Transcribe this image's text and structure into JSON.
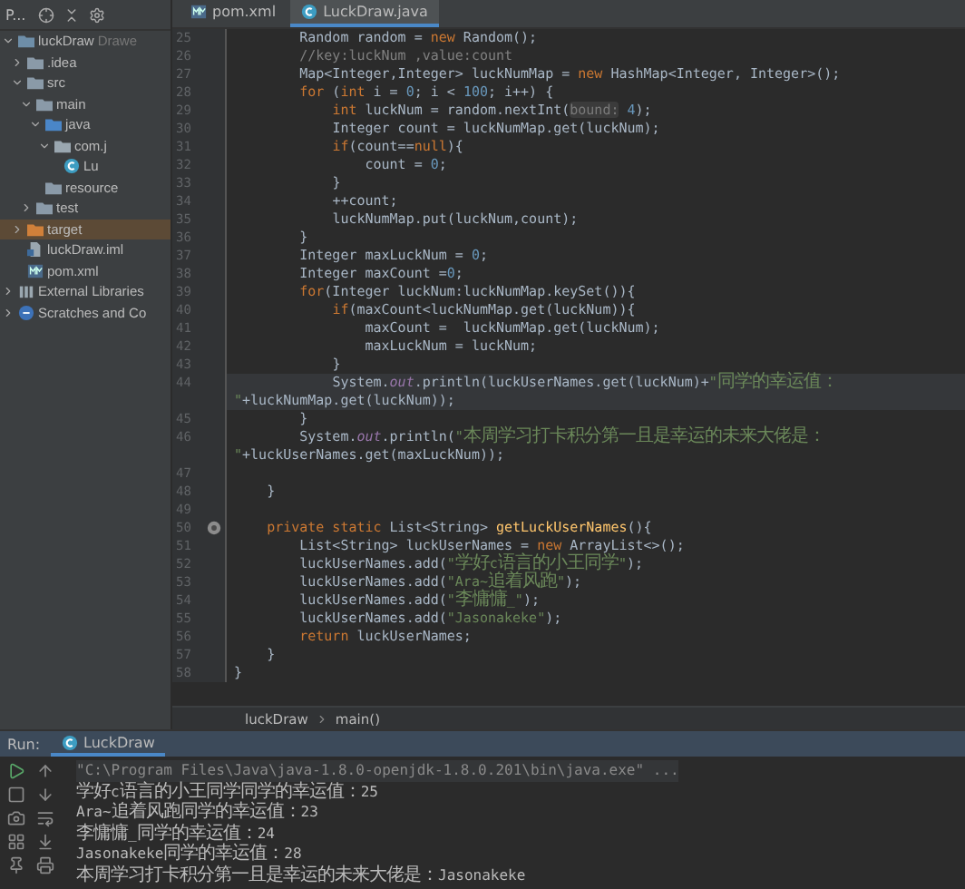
{
  "project_panel": {
    "title": "P...",
    "tree": [
      {
        "label": "luckDraw",
        "hint": "Drawe",
        "kind": "module",
        "expanded": true,
        "selected": false,
        "children": [
          {
            "label": ".idea",
            "kind": "folder",
            "expanded": false,
            "selected": false
          },
          {
            "label": "src",
            "kind": "folder",
            "expanded": true,
            "selected": false,
            "children": [
              {
                "label": "main",
                "kind": "folder",
                "expanded": true,
                "selected": false,
                "children": [
                  {
                    "label": "java",
                    "kind": "source",
                    "expanded": true,
                    "selected": false,
                    "children": [
                      {
                        "label": "com.j",
                        "kind": "package",
                        "expanded": true,
                        "selected": false,
                        "children": [
                          {
                            "label": "Lu",
                            "kind": "class",
                            "selected": false
                          }
                        ]
                      }
                    ]
                  },
                  {
                    "label": "resource",
                    "kind": "resources",
                    "selected": false
                  }
                ]
              },
              {
                "label": "test",
                "kind": "folder",
                "expanded": false,
                "selected": false
              }
            ]
          },
          {
            "label": "target",
            "kind": "excluded",
            "expanded": false,
            "selected": true
          },
          {
            "label": "luckDraw.iml",
            "kind": "iml",
            "selected": false
          },
          {
            "label": "pom.xml",
            "kind": "maven",
            "selected": false
          }
        ]
      },
      {
        "label": "External Libraries",
        "kind": "library",
        "expanded": false,
        "selected": false
      },
      {
        "label": "Scratches and Co",
        "kind": "scratch",
        "expanded": false,
        "selected": false
      }
    ]
  },
  "editor": {
    "tabs": [
      {
        "label": "pom.xml",
        "kind": "maven",
        "selected": false
      },
      {
        "label": "LuckDraw.java",
        "kind": "class",
        "selected": true
      }
    ],
    "lines": [
      {
        "number": "25",
        "current": false,
        "tokens": [
          {
            "text": "        Random random = ",
            "kind": "plain"
          },
          {
            "text": "new",
            "kind": "kw"
          },
          {
            "text": " Random();",
            "kind": "plain"
          }
        ]
      },
      {
        "number": "26",
        "current": false,
        "tokens": [
          {
            "text": "        //key:luckNum ,value:count",
            "kind": "comment"
          }
        ]
      },
      {
        "number": "27",
        "current": false,
        "tokens": [
          {
            "text": "        Map<Integer,Integer> luckNumMap = ",
            "kind": "plain"
          },
          {
            "text": "new",
            "kind": "kw"
          },
          {
            "text": " HashMap<Integer, Integer>();",
            "kind": "plain"
          }
        ]
      },
      {
        "number": "28",
        "current": false,
        "tokens": [
          {
            "text": "        for",
            "kind": "kw"
          },
          {
            "text": " (",
            "kind": "plain"
          },
          {
            "text": "int",
            "kind": "kw"
          },
          {
            "text": " i = ",
            "kind": "plain"
          },
          {
            "text": "0",
            "kind": "num"
          },
          {
            "text": "; i < ",
            "kind": "plain"
          },
          {
            "text": "100",
            "kind": "num"
          },
          {
            "text": "; i++) {",
            "kind": "plain"
          }
        ]
      },
      {
        "number": "29",
        "current": false,
        "tokens": [
          {
            "text": "            int",
            "kind": "kw"
          },
          {
            "text": " luckNum = random.nextInt(",
            "kind": "plain"
          },
          {
            "text": "bound:",
            "kind": "hint"
          },
          {
            "text": " 4",
            "kind": "num"
          },
          {
            "text": ");",
            "kind": "plain"
          }
        ]
      },
      {
        "number": "30",
        "current": false,
        "tokens": [
          {
            "text": "            Integer count = luckNumMap.get(luckNum);",
            "kind": "plain"
          }
        ]
      },
      {
        "number": "31",
        "current": false,
        "tokens": [
          {
            "text": "            if",
            "kind": "kw"
          },
          {
            "text": "(count==",
            "kind": "plain"
          },
          {
            "text": "null",
            "kind": "kw"
          },
          {
            "text": "){",
            "kind": "plain"
          }
        ]
      },
      {
        "number": "32",
        "current": false,
        "tokens": [
          {
            "text": "                count = ",
            "kind": "plain"
          },
          {
            "text": "0",
            "kind": "num"
          },
          {
            "text": ";",
            "kind": "plain"
          }
        ]
      },
      {
        "number": "33",
        "current": false,
        "tokens": [
          {
            "text": "            }",
            "kind": "plain"
          }
        ]
      },
      {
        "number": "34",
        "current": false,
        "tokens": [
          {
            "text": "            ++count;",
            "kind": "plain"
          }
        ]
      },
      {
        "number": "35",
        "current": false,
        "tokens": [
          {
            "text": "            luckNumMap.put(luckNum,count);",
            "kind": "plain"
          }
        ]
      },
      {
        "number": "36",
        "current": false,
        "tokens": [
          {
            "text": "        }",
            "kind": "plain"
          }
        ]
      },
      {
        "number": "37",
        "current": false,
        "tokens": [
          {
            "text": "        Integer maxLuckNum = ",
            "kind": "plain"
          },
          {
            "text": "0",
            "kind": "num"
          },
          {
            "text": ";",
            "kind": "plain"
          }
        ]
      },
      {
        "number": "38",
        "current": false,
        "tokens": [
          {
            "text": "        Integer maxCount =",
            "kind": "plain"
          },
          {
            "text": "0",
            "kind": "num"
          },
          {
            "text": ";",
            "kind": "plain"
          }
        ]
      },
      {
        "number": "39",
        "current": false,
        "tokens": [
          {
            "text": "        for",
            "kind": "kw"
          },
          {
            "text": "(Integer luckNum:luckNumMap.keySet()){",
            "kind": "plain"
          }
        ]
      },
      {
        "number": "40",
        "current": false,
        "tokens": [
          {
            "text": "            if",
            "kind": "kw"
          },
          {
            "text": "(maxCount<luckNumMap.get(luckNum)){",
            "kind": "plain"
          }
        ]
      },
      {
        "number": "41",
        "current": false,
        "tokens": [
          {
            "text": "                maxCount =  luckNumMap.get(luckNum);",
            "kind": "plain"
          }
        ]
      },
      {
        "number": "42",
        "current": false,
        "tokens": [
          {
            "text": "                maxLuckNum = luckNum;",
            "kind": "plain"
          }
        ]
      },
      {
        "number": "43",
        "current": false,
        "tokens": [
          {
            "text": "            }",
            "kind": "plain"
          }
        ]
      },
      {
        "number": "44",
        "current": true,
        "tokens": [
          {
            "text": "            System.",
            "kind": "plain"
          },
          {
            "text": "out",
            "kind": "field"
          },
          {
            "text": ".println(luckUserNames.get(luckNum)+",
            "kind": "plain"
          },
          {
            "text": "\"同学的幸运值：  \"",
            "kind": "str"
          },
          {
            "text": "+luckNumMap.get(luckNum));",
            "kind": "plain"
          }
        ]
      },
      {
        "number": "45",
        "current": false,
        "tokens": [
          {
            "text": "        }",
            "kind": "plain"
          }
        ]
      },
      {
        "number": "46",
        "current": false,
        "tokens": [
          {
            "text": "        System.",
            "kind": "plain"
          },
          {
            "text": "out",
            "kind": "field"
          },
          {
            "text": ".println(",
            "kind": "plain"
          },
          {
            "text": "\"本周学习打卡积分第一且是幸运的未来大佬是：  \"",
            "kind": "str"
          },
          {
            "text": "+luckUserNames.get(maxLuckNum));",
            "kind": "plain"
          }
        ]
      },
      {
        "number": "47"
      },
      {
        "number": "48",
        "current": false,
        "tokens": [
          {
            "text": "    }",
            "kind": "plain"
          }
        ]
      },
      {
        "number": "49"
      },
      {
        "number": "50",
        "kind": "marked",
        "current": false,
        "tokens": [
          {
            "text": "    private static",
            "kind": "kw"
          },
          {
            "text": " List<String> ",
            "kind": "plain"
          },
          {
            "text": "getLuckUserNames",
            "kind": "method"
          },
          {
            "text": "(){",
            "kind": "plain"
          }
        ]
      },
      {
        "number": "51",
        "current": false,
        "tokens": [
          {
            "text": "        List<String> luckUserNames = ",
            "kind": "plain"
          },
          {
            "text": "new",
            "kind": "kw"
          },
          {
            "text": " ArrayList<>();",
            "kind": "plain"
          }
        ]
      },
      {
        "number": "52",
        "current": false,
        "tokens": [
          {
            "text": "        luckUserNames.add(",
            "kind": "plain"
          },
          {
            "text": "\"学好c语言的小王同学\"",
            "kind": "str"
          },
          {
            "text": ");",
            "kind": "plain"
          }
        ]
      },
      {
        "number": "53",
        "current": false,
        "tokens": [
          {
            "text": "        luckUserNames.add(",
            "kind": "plain"
          },
          {
            "text": "\"Ara~追着风跑\"",
            "kind": "str"
          },
          {
            "text": ");",
            "kind": "plain"
          }
        ]
      },
      {
        "number": "54",
        "current": false,
        "tokens": [
          {
            "text": "        luckUserNames.add(",
            "kind": "plain"
          },
          {
            "text": "\"李慵慵_\"",
            "kind": "str"
          },
          {
            "text": ");",
            "kind": "plain"
          }
        ]
      },
      {
        "number": "55",
        "current": false,
        "tokens": [
          {
            "text": "        luckUserNames.add(",
            "kind": "plain"
          },
          {
            "text": "\"Jasonakeke\"",
            "kind": "str"
          },
          {
            "text": ");",
            "kind": "plain"
          }
        ]
      },
      {
        "number": "56",
        "current": false,
        "tokens": [
          {
            "text": "        return",
            "kind": "kw"
          },
          {
            "text": " luckUserNames;",
            "kind": "plain"
          }
        ]
      },
      {
        "number": "57",
        "current": false,
        "tokens": [
          {
            "text": "    }",
            "kind": "plain"
          }
        ]
      },
      {
        "number": "58",
        "current": false,
        "tokens": [
          {
            "text": "}",
            "kind": "plain"
          }
        ]
      }
    ],
    "breadcrumb": [
      "luckDraw",
      "main()"
    ]
  },
  "run_panel": {
    "label": "Run:",
    "tabs": [
      {
        "label": "LuckDraw",
        "selected": true
      }
    ],
    "output": [
      {
        "kind": "command",
        "text": "\"C:\\Program Files\\Java\\java-1.8.0-openjdk-1.8.0.201\\bin\\java.exe\" ..."
      },
      {
        "kind": "output",
        "text": "学好c语言的小王同学同学的幸运值：25"
      },
      {
        "kind": "output",
        "text": "Ara~追着风跑同学的幸运值：23"
      },
      {
        "kind": "output",
        "text": "李慵慵_同学的幸运值：24"
      },
      {
        "kind": "output",
        "text": "Jasonakeke同学的幸运值：28"
      },
      {
        "kind": "output",
        "text": "本周学习打卡积分第一且是幸运的未来大佬是：Jasonakeke"
      }
    ]
  }
}
